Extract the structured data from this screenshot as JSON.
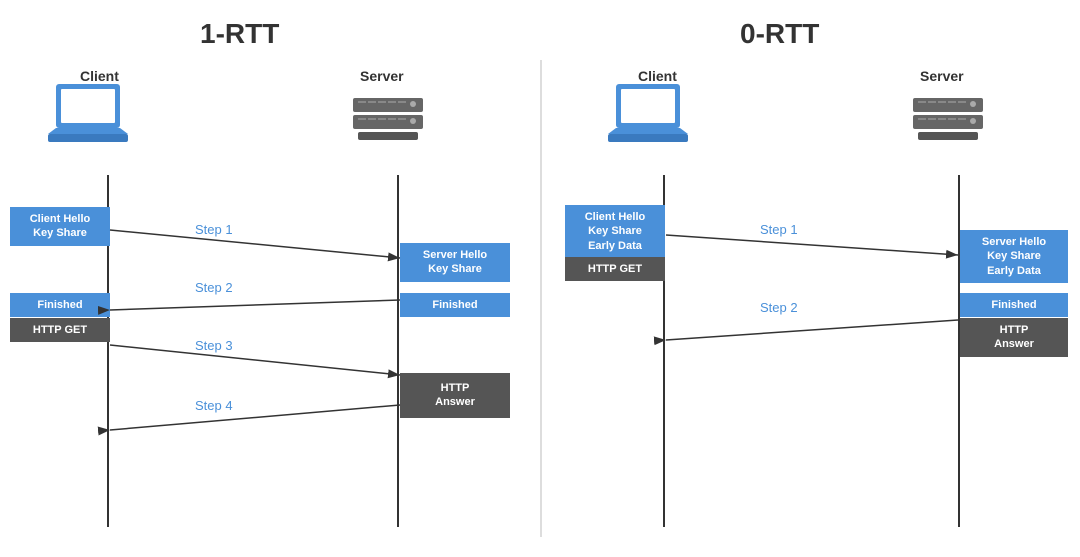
{
  "diagram": {
    "title_1rtt": "1-RTT",
    "title_0rtt": "0-RTT",
    "left": {
      "client_label": "Client",
      "server_label": "Server",
      "msg_client_hello": "Client Hello\nKey Share",
      "msg_server_hello": "Server Hello\nKey Share",
      "msg_finished_server": "Finished",
      "msg_finished_client": "Finished",
      "msg_http_get": "HTTP GET",
      "msg_http_answer": "HTTP\nAnswer",
      "step1": "Step 1",
      "step2": "Step 2",
      "step3": "Step 3",
      "step4": "Step 4"
    },
    "right": {
      "client_label": "Client",
      "server_label": "Server",
      "msg_client_hello": "Client Hello\nKey Share\nEarly Data",
      "msg_http_get": "HTTP GET",
      "msg_server_hello": "Server Hello\nKey Share\nEarly Data",
      "msg_finished_server": "Finished",
      "msg_http_answer": "HTTP\nAnswer",
      "step1": "Step 1",
      "step2": "Step 2"
    }
  }
}
